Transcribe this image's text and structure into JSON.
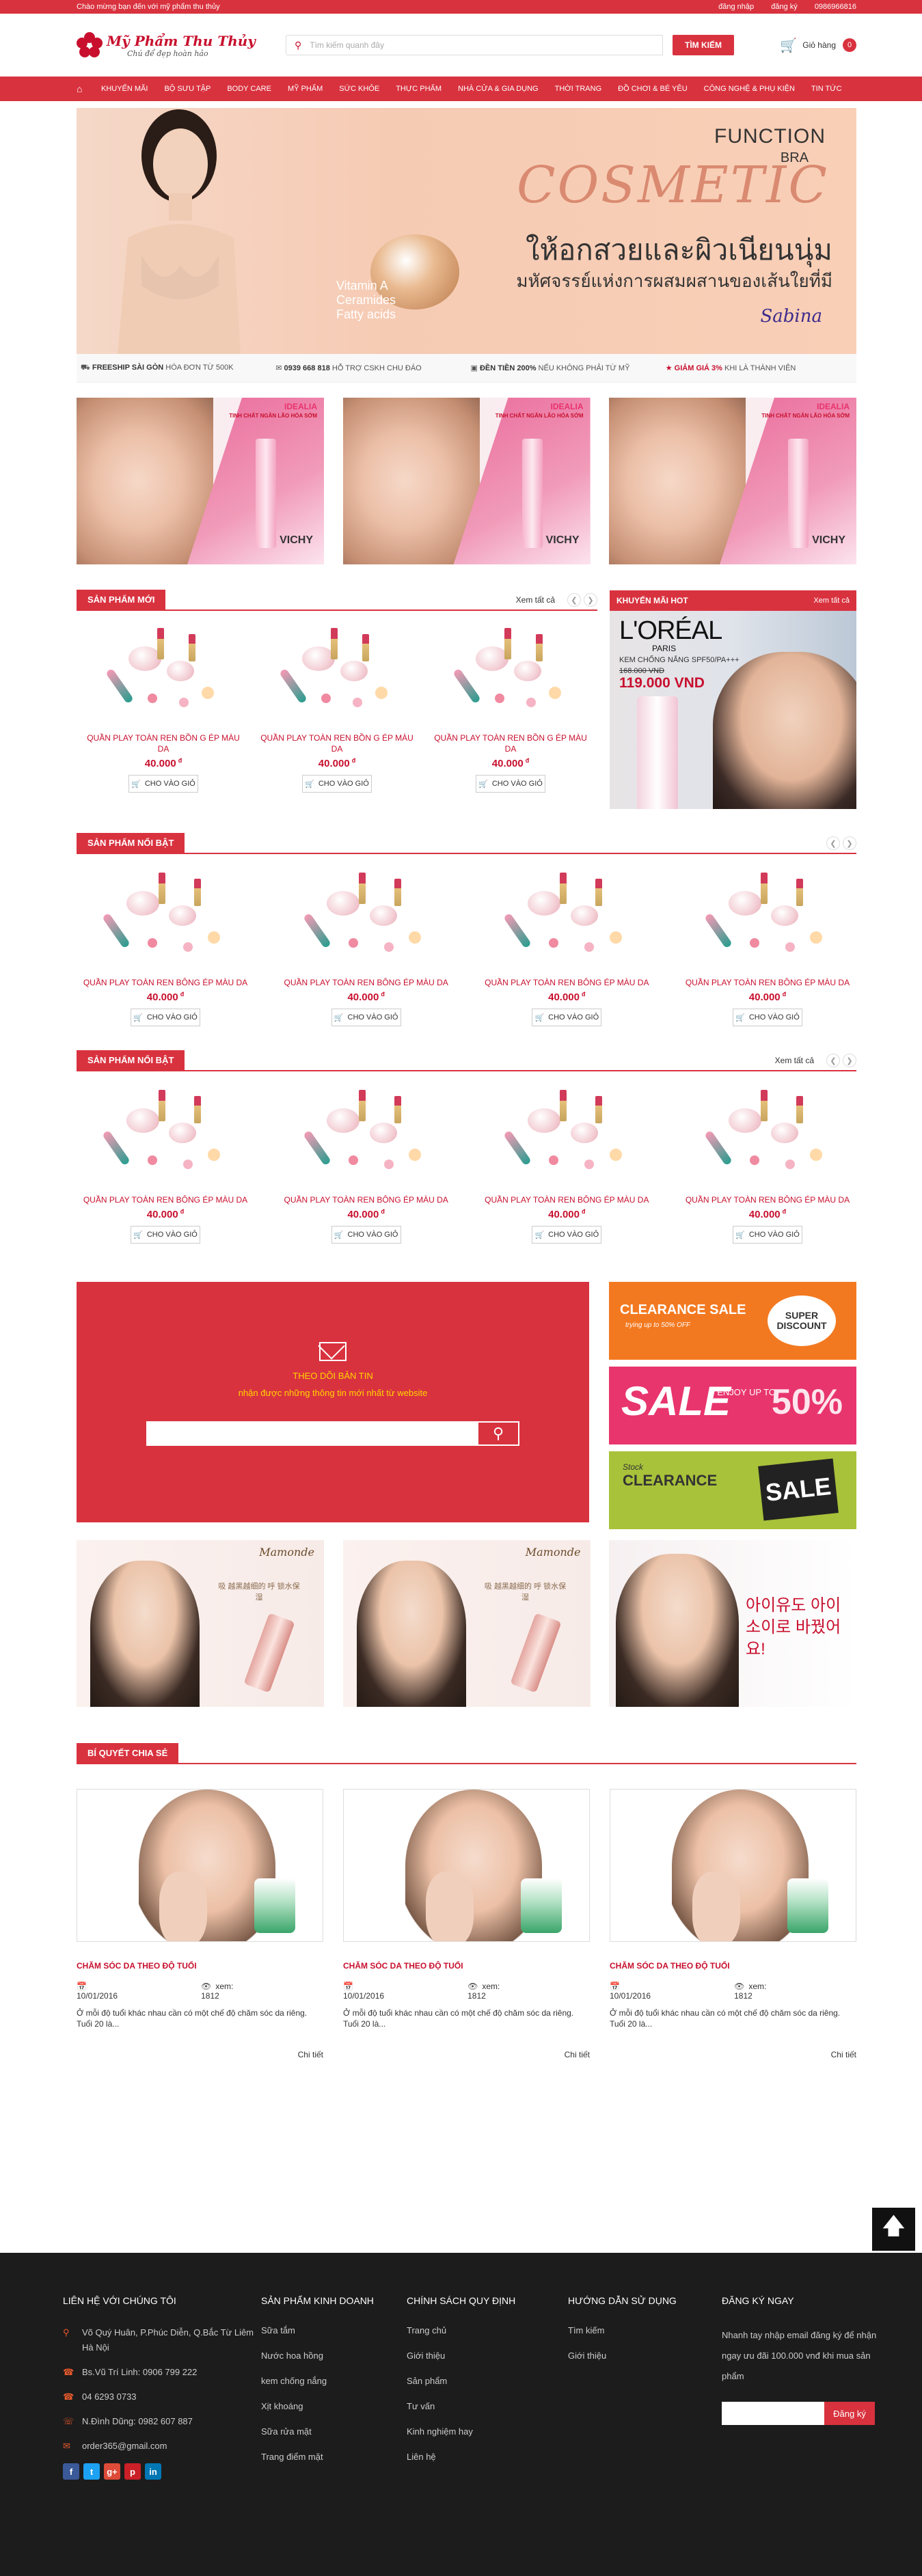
{
  "topbar": {
    "welcome": "Chào mừng bạn đến với mỹ phẩm thu thủy",
    "login": "đăng nhập",
    "register": "đăng ký",
    "phone": "0986966816"
  },
  "header": {
    "logo_title": "Mỹ Phẩm Thu Thủy",
    "logo_slogan": "Chú để đẹp hoàn hảo",
    "search_placeholder": "Tìm kiếm quanh đây",
    "search_button": "TÌM KIẾM",
    "cart_label": "Giỏ hàng",
    "cart_count": "0"
  },
  "nav": [
    "KHUYẾN MÃI",
    "BỘ SƯU TẬP",
    "BODY CARE",
    "MỸ PHẨM",
    "SỨC KHỎE",
    "THỰC PHẨM",
    "NHÀ CỬA & GIA DỤNG",
    "THỜI TRANG",
    "ĐỒ CHƠI & BÉ YÊU",
    "CÔNG NGHỆ & PHỤ KIỆN",
    "TIN TỨC"
  ],
  "banner": {
    "function": "FUNCTION",
    "bra": "BRA",
    "cosmetic": "COSMETIC",
    "thai1": "ให้อกสวยและผิวเนียนนุ่ม",
    "thai2": "มหัศจรรย์แห่งการผสมผสานของเส้นใยที่มี",
    "jar_text": "Vitamin A\nCeramides\nFatty acids",
    "signature": "Sabina"
  },
  "strip": [
    {
      "bold": "FREESHIP SÀI GÒN",
      "text": " HÓA ĐƠN TỪ 500K"
    },
    {
      "bold": "0939 668 818",
      "text": " HỖ TRỢ CSKH CHU ĐÁO"
    },
    {
      "bold": "ĐỀN TIỀN 200%",
      "text": " NẾU KHÔNG PHẢI TỪ MỸ"
    },
    {
      "bold": "GIẢM GIÁ 3%",
      "text": " KHI LÀ THÀNH VIÊN"
    }
  ],
  "promo": {
    "brand": "IDEALIA",
    "subtitle": "TINH CHẤT NGĂN LÃO HÓA SỚM",
    "logo": "VICHY"
  },
  "new_products": {
    "title": "SẢN PHẨM MỚI",
    "more": "Xem tất cả",
    "items": [
      {
        "name": "QUẦN PLAY TOÀN REN BỒN G ÉP MÀU DA",
        "price": "40.000",
        "currency": "đ",
        "button": "CHO VÀO GIỎ"
      },
      {
        "name": "QUẦN PLAY TOÀN REN BỒN G ÉP MÀU DA",
        "price": "40.000",
        "currency": "đ",
        "button": "CHO VÀO GIỎ"
      },
      {
        "name": "QUẦN PLAY TOÀN REN BỒN G ÉP MÀU DA",
        "price": "40.000",
        "currency": "đ",
        "button": "CHO VÀO GIỎ"
      }
    ]
  },
  "hot": {
    "title": "KHUYẾN MÃI HOT",
    "more": "Xem tất cả",
    "brand": "L'ORÉAL",
    "paris": "PARIS",
    "product": "KEM CHỐNG NẮNG SPF50/PA+++",
    "old_price": "168.000 VND",
    "new_price": "119.000 VND"
  },
  "featured1": {
    "title": "SẢN PHẨM NỔI BẬT",
    "items": [
      {
        "name": "QUẦN PLAY TOÀN REN BÔNG ÉP MÀU DA",
        "price": "40.000",
        "currency": "đ",
        "button": "CHO VÀO GIỎ"
      },
      {
        "name": "QUẦN PLAY TOÀN REN BÔNG ÉP MÀU DA",
        "price": "40.000",
        "currency": "đ",
        "button": "CHO VÀO GIỎ"
      },
      {
        "name": "QUẦN PLAY TOÀN REN BÔNG ÉP MÀU DA",
        "price": "40.000",
        "currency": "đ",
        "button": "CHO VÀO GIỎ"
      },
      {
        "name": "QUẦN PLAY TOÀN REN BÔNG ÉP MÀU DA",
        "price": "40.000",
        "currency": "đ",
        "button": "CHO VÀO GIỎ"
      }
    ]
  },
  "featured2": {
    "title": "SẢN PHẨM NỔI BẬT",
    "more": "Xem tất cả",
    "items": [
      {
        "name": "QUẦN PLAY TOÀN REN BÔNG ÉP MÀU DA",
        "price": "40.000",
        "currency": "đ",
        "button": "CHO VÀO GIỎ"
      },
      {
        "name": "QUẦN PLAY TOÀN REN BÔNG ÉP MÀU DA",
        "price": "40.000",
        "currency": "đ",
        "button": "CHO VÀO GIỎ"
      },
      {
        "name": "QUẦN PLAY TOÀN REN BÔNG ÉP MÀU DA",
        "price": "40.000",
        "currency": "đ",
        "button": "CHO VÀO GIỎ"
      },
      {
        "name": "QUẦN PLAY TOÀN REN BÔNG ÉP MÀU DA",
        "price": "40.000",
        "currency": "đ",
        "button": "CHO VÀO GIỎ"
      }
    ]
  },
  "newsletter": {
    "title": "THEO DÕI BẢN TIN",
    "subtitle": "nhận được những thông tin mới nhất từ website"
  },
  "sales": {
    "s1_a": "CLEARANCE SALE",
    "s1_b": "trying up to 50% OFF",
    "s1_c": "SUPER DISCOUNT",
    "s2_big": "SALE",
    "s2_upto": "ENJOY UP TO",
    "s2_pct": "50%",
    "s3_lbl2": "Stock",
    "s3_lbl": "CLEARANCE",
    "s3_tag": "SALE"
  },
  "ads": {
    "brand": "Mamonde",
    "korean_caption": "아이유도 아이소이로 바꿨어요!",
    "promo_caption": "吸 越黑越细的 呼 锁水保湿"
  },
  "blog": {
    "title": "BÍ QUYẾT CHIA SẺ",
    "posts": [
      {
        "title": "CHĂM SÓC DA THEO ĐỘ TUỔI",
        "date": "10/01/2016",
        "views": "xem: 1812",
        "desc": "Ở mỗi độ tuổi khác nhau cần có một chế độ chăm sóc da riêng. Tuổi 20 là...",
        "more": "Chi tiết"
      },
      {
        "title": "CHĂM SÓC DA THEO ĐỘ TUỔI",
        "date": "10/01/2016",
        "views": "xem: 1812",
        "desc": "Ở mỗi độ tuổi khác nhau cần có một chế độ chăm sóc da riêng. Tuổi 20 là...",
        "more": "Chi tiết"
      },
      {
        "title": "CHĂM SÓC DA THEO ĐỘ TUỔI",
        "date": "10/01/2016",
        "views": "xem: 1812",
        "desc": "Ở mỗi độ tuổi khác nhau cần có một chế độ chăm sóc da riêng. Tuổi 20 là...",
        "more": "Chi tiết"
      }
    ]
  },
  "footer": {
    "contact_title": "LIÊN HỆ VỚI CHÚNG TÔI",
    "address": "Võ Quý Huân, P.Phúc Diễn, Q.Bắc Từ Liêm Hà Nội",
    "phone1": "Bs.Vũ Trí Linh: 0906 799 222",
    "phone2": "04 6293 0733",
    "phone3": "N.Đình Dũng: 0982 607 887",
    "email": "order365@gmail.com",
    "col2_title": "SẢN PHẨM KINH DOANH",
    "col2": [
      "Sữa tắm",
      "Nước hoa hồng",
      "kem chống nắng",
      "Xịt khoáng",
      "Sữa rửa mặt",
      "Trang điểm mặt"
    ],
    "col3_title": "CHÍNH SÁCH QUY ĐỊNH",
    "col3": [
      "Trang chủ",
      "Giới thiệu",
      "Sản phẩm",
      "Tư vấn",
      "Kinh nghiệm hay",
      "Liên hệ"
    ],
    "col4_title": "HƯỚNG DẪN SỬ DỤNG",
    "col4": [
      "Tìm kiếm",
      "Giới thiệu"
    ],
    "col5_title": "ĐĂNG KÝ NGAY",
    "col5_text": "Nhanh tay nhập email đăng ký để nhận ngay ưu đãi 100.000 vnđ khi mua sản phẩm",
    "col5_button": "Đăng ký",
    "social": [
      "f",
      "t",
      "g+",
      "p",
      "in"
    ]
  },
  "colors": {
    "brand": "#d9323f",
    "dark": "#1c1c1c"
  }
}
